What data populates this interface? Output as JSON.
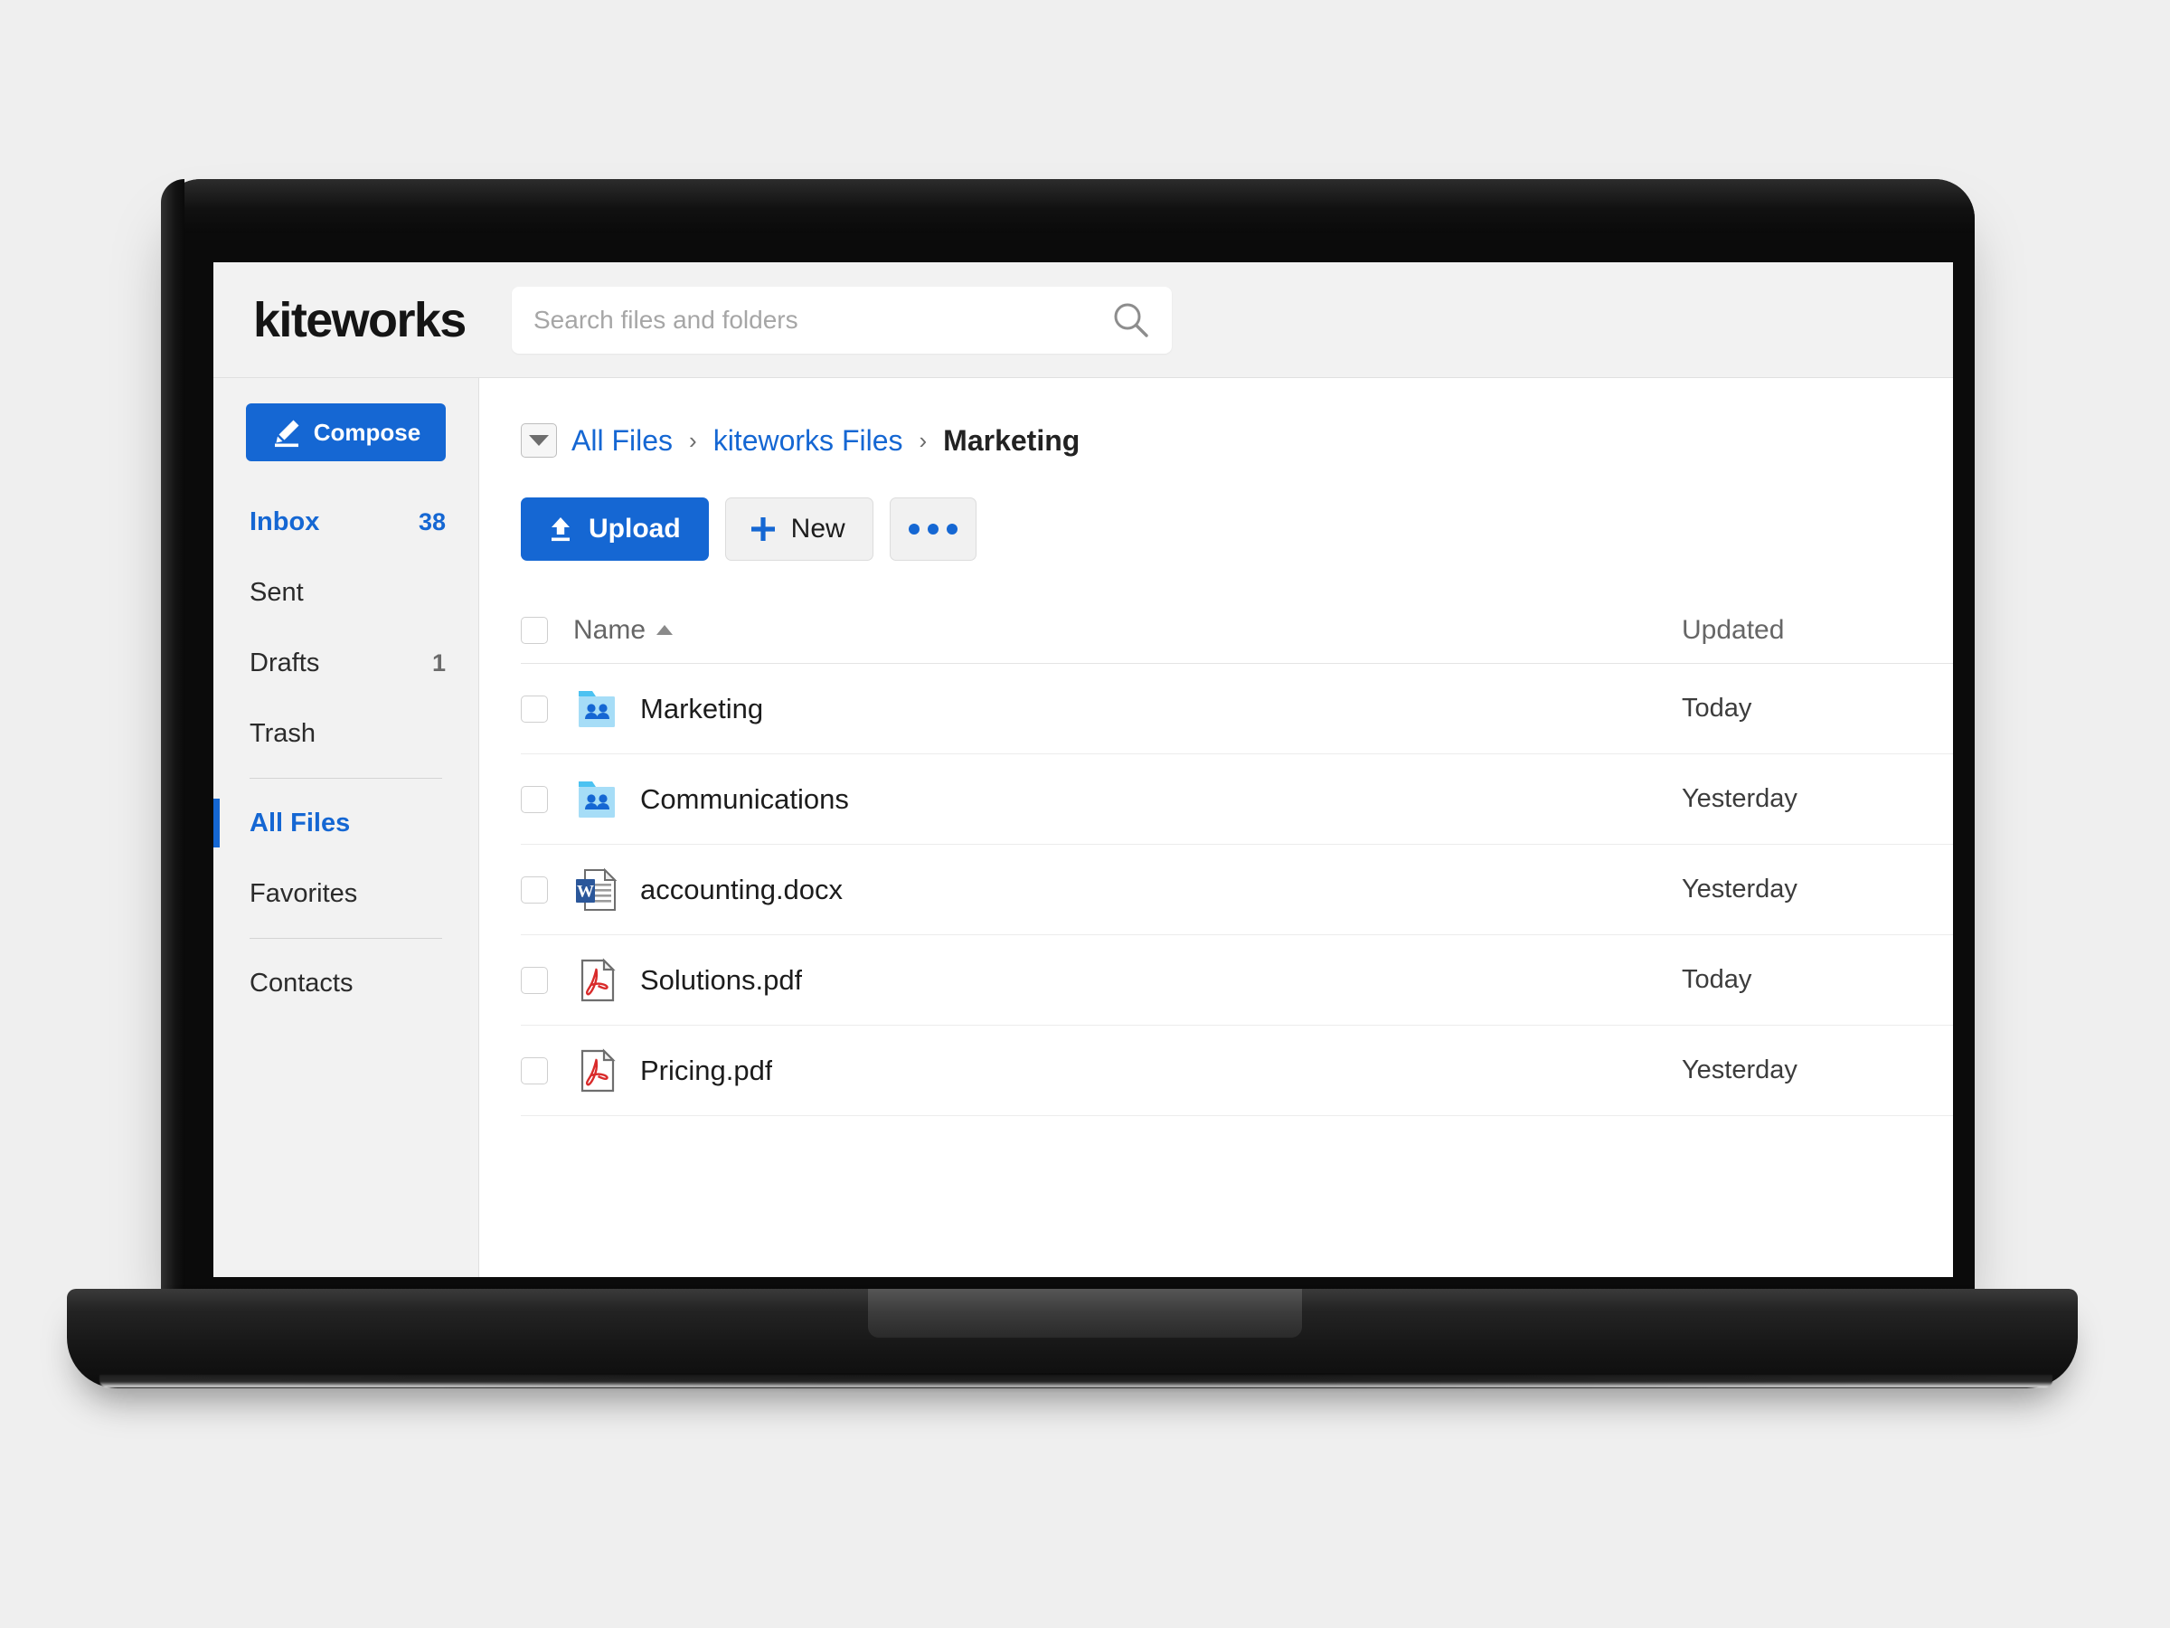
{
  "brand": {
    "name": "kiteworks"
  },
  "search": {
    "placeholder": "Search files and folders",
    "value": "",
    "icon": "search-icon"
  },
  "sidebar": {
    "compose": {
      "label": "Compose",
      "icon": "pencil-icon"
    },
    "groups": [
      {
        "items": [
          {
            "label": "Inbox",
            "count": "38",
            "accent": true,
            "selected": false
          },
          {
            "label": "Sent",
            "count": "",
            "accent": false,
            "selected": false
          },
          {
            "label": "Drafts",
            "count": "1",
            "accent": false,
            "selected": false
          },
          {
            "label": "Trash",
            "count": "",
            "accent": false,
            "selected": false
          }
        ]
      },
      {
        "items": [
          {
            "label": "All Files",
            "count": "",
            "accent": true,
            "selected": true
          },
          {
            "label": "Favorites",
            "count": "",
            "accent": false,
            "selected": false
          }
        ]
      },
      {
        "items": [
          {
            "label": "Contacts",
            "count": "",
            "accent": false,
            "selected": false
          }
        ]
      }
    ]
  },
  "breadcrumb": {
    "toggle_icon": "chevron-down-icon",
    "separator": "›",
    "links": [
      "All Files",
      "kiteworks Files"
    ],
    "current": "Marketing"
  },
  "toolbar": {
    "upload_label": "Upload",
    "upload_icon": "upload-icon",
    "new_label": "New",
    "new_icon": "plus-icon",
    "more_icon": "ellipsis-icon"
  },
  "file_table": {
    "columns": {
      "name": "Name",
      "updated": "Updated"
    },
    "sort": {
      "column": "Name",
      "direction": "asc",
      "icon": "caret-up-icon"
    },
    "select_all": false,
    "rows": [
      {
        "name": "Marketing",
        "icon": "shared-folder-icon",
        "updated": "Today",
        "selected": false
      },
      {
        "name": "Communications",
        "icon": "shared-folder-icon",
        "updated": "Yesterday",
        "selected": false
      },
      {
        "name": "accounting.docx",
        "icon": "word-doc-icon",
        "updated": "Yesterday",
        "selected": false
      },
      {
        "name": "Solutions.pdf",
        "icon": "pdf-icon",
        "updated": "Today",
        "selected": false
      },
      {
        "name": "Pricing.pdf",
        "icon": "pdf-icon",
        "updated": "Yesterday",
        "selected": false
      }
    ]
  },
  "colors": {
    "accent_blue": "#1567d3",
    "folder_light": "#a6ddf7",
    "folder_tab": "#4cc2f1",
    "folder_people": "#1567d3",
    "pdf_red": "#d92b2b",
    "word_blue": "#2b579a",
    "page_bg": "#efefef",
    "chrome_bg": "#f2f2f2"
  }
}
